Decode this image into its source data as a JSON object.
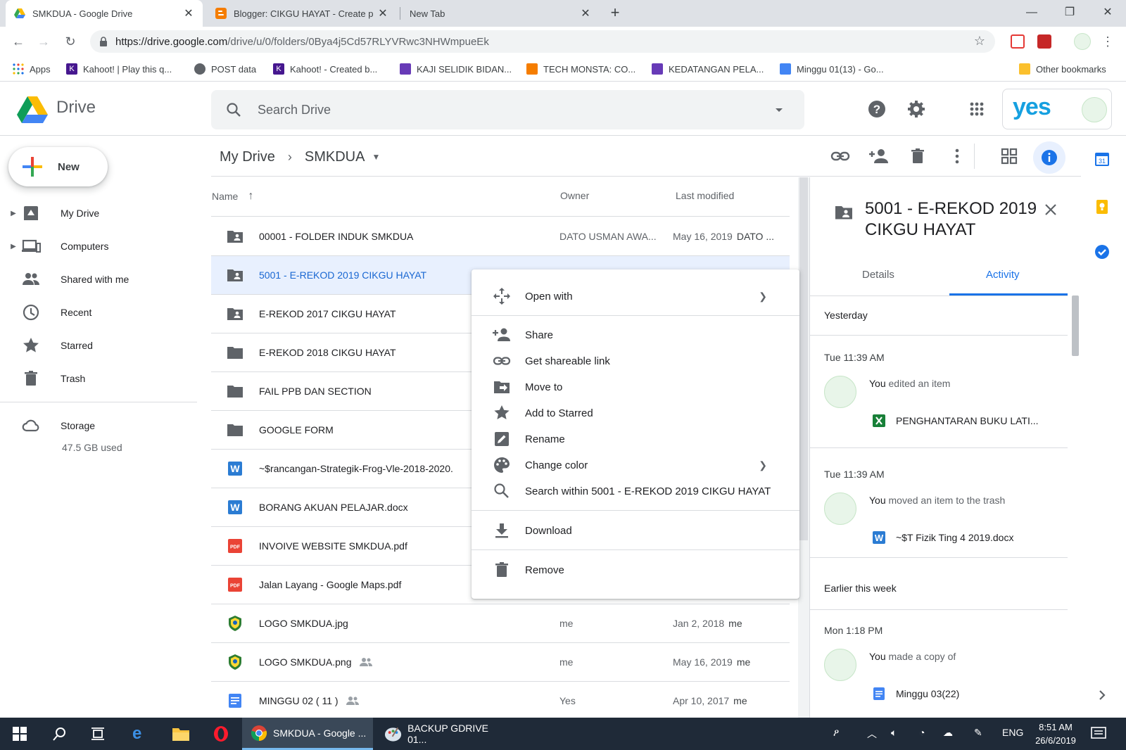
{
  "browser": {
    "tabs": [
      {
        "title": "SMKDUA - Google Drive",
        "active": true
      },
      {
        "title": "Blogger: CIKGU HAYAT - Create p",
        "active": false
      },
      {
        "title": "New Tab",
        "active": false
      }
    ],
    "new_tab": "+",
    "url_host": "https://drive.google.com",
    "url_path": "/drive/u/0/folders/0Bya4j5Cd57RLYVRwc3NHWmpueEk",
    "bookmarks": [
      {
        "label": "Apps"
      },
      {
        "label": "Kahoot! | Play this q..."
      },
      {
        "label": "POST data"
      },
      {
        "label": "Kahoot! - Created b..."
      },
      {
        "label": "KAJI SELIDIK BIDAN..."
      },
      {
        "label": "TECH MONSTA: CO..."
      },
      {
        "label": "KEDATANGAN PELA..."
      },
      {
        "label": "Minggu 01(13) - Go..."
      },
      {
        "label": "Other bookmarks"
      }
    ]
  },
  "drive": {
    "logo_text": "Drive",
    "search_placeholder": "Search Drive",
    "account_brand": "yes",
    "new_button": "New",
    "nav": [
      {
        "label": "My Drive",
        "icon": "my-drive-icon"
      },
      {
        "label": "Computers",
        "icon": "computers-icon"
      },
      {
        "label": "Shared with me",
        "icon": "shared-icon"
      },
      {
        "label": "Recent",
        "icon": "clock-icon"
      },
      {
        "label": "Starred",
        "icon": "star-icon"
      },
      {
        "label": "Trash",
        "icon": "trash-icon"
      }
    ],
    "storage": {
      "label": "Storage",
      "used": "47.5 GB used"
    },
    "breadcrumb": {
      "root": "My Drive",
      "current": "SMKDUA"
    },
    "columns": {
      "name": "Name",
      "owner": "Owner",
      "modified": "Last modified"
    },
    "files": [
      {
        "name": "00001 - FOLDER INDUK SMKDUA",
        "type": "shared-folder",
        "owner": "DATO USMAN AWA...",
        "modified": "May 16, 2019",
        "modified_by": "DATO ..."
      },
      {
        "name": "5001 - E-REKOD 2019 CIKGU HAYAT",
        "type": "shared-folder",
        "owner": "",
        "modified": "",
        "modified_by": "",
        "selected": true
      },
      {
        "name": "E-REKOD 2017 CIKGU HAYAT",
        "type": "shared-folder",
        "owner": "",
        "modified": "",
        "modified_by": ""
      },
      {
        "name": "E-REKOD 2018 CIKGU HAYAT",
        "type": "folder",
        "owner": "",
        "modified": "",
        "modified_by": ""
      },
      {
        "name": "FAIL PPB DAN SECTION",
        "type": "folder",
        "owner": "",
        "modified": "",
        "modified_by": ""
      },
      {
        "name": "GOOGLE FORM",
        "type": "folder",
        "owner": "",
        "modified": "",
        "modified_by": ""
      },
      {
        "name": "~$rancangan-Strategik-Frog-Vle-2018-2020.",
        "type": "word",
        "owner": "",
        "modified": "",
        "modified_by": ""
      },
      {
        "name": "BORANG AKUAN PELAJAR.docx",
        "type": "word",
        "owner": "",
        "modified": "",
        "modified_by": ""
      },
      {
        "name": "INVOIVE WEBSITE SMKDUA.pdf",
        "type": "pdf",
        "owner": "",
        "modified": "",
        "modified_by": ""
      },
      {
        "name": "Jalan Layang - Google Maps.pdf",
        "type": "pdf",
        "owner": "",
        "modified": "",
        "modified_by": ""
      },
      {
        "name": "LOGO SMKDUA.jpg",
        "type": "image",
        "owner": "me",
        "modified": "Jan 2, 2018",
        "modified_by": "me"
      },
      {
        "name": "LOGO SMKDUA.png",
        "type": "image",
        "owner": "me",
        "modified": "May 16, 2019",
        "modified_by": "me",
        "shared": true
      },
      {
        "name": "MINGGU 02 ( 11 )",
        "type": "doc",
        "owner": "Yes",
        "modified": "Apr 10, 2017",
        "modified_by": "me",
        "shared": true
      }
    ],
    "context_menu": [
      {
        "label": "Open with",
        "icon": "open-with-icon",
        "submenu": true
      },
      {
        "label": "Share",
        "icon": "share-icon"
      },
      {
        "label": "Get shareable link",
        "icon": "link-icon"
      },
      {
        "label": "Move to",
        "icon": "move-to-icon"
      },
      {
        "label": "Add to Starred",
        "icon": "star-icon"
      },
      {
        "label": "Rename",
        "icon": "rename-icon"
      },
      {
        "label": "Change color",
        "icon": "palette-icon",
        "submenu": true
      },
      {
        "label": "Search within 5001 - E-REKOD 2019 CIKGU HAYAT",
        "icon": "search-icon"
      },
      {
        "label": "Download",
        "icon": "download-icon"
      },
      {
        "label": "Remove",
        "icon": "trash-icon"
      }
    ],
    "details": {
      "title": "5001 - E-REKOD 2019 CIKGU HAYAT",
      "tab_details": "Details",
      "tab_activity": "Activity",
      "section_yesterday": "Yesterday",
      "section_earlier": "Earlier this week",
      "activities": [
        {
          "time": "Tue 11:39 AM",
          "actor": "You",
          "action": "edited an item",
          "file": "PENGHANTARAN BUKU LATI...",
          "file_type": "sheet"
        },
        {
          "time": "Tue 11:39 AM",
          "actor": "You",
          "action": "moved an item to the trash",
          "file": "~$T Fizik Ting 4 2019.docx",
          "file_type": "word"
        },
        {
          "time": "Mon 1:18 PM",
          "actor": "You",
          "action": "made a copy of",
          "file": "Minggu 03(22)",
          "file_type": "doc"
        }
      ]
    }
  },
  "taskbar": {
    "apps": [
      {
        "label": "SMKDUA - Google ...",
        "active": true
      },
      {
        "label": "BACKUP GDRIVE 01...",
        "active": false
      }
    ],
    "language": "ENG",
    "time": "8:51 AM",
    "date": "26/6/2019"
  },
  "colors": {
    "accent": "#1a73e8",
    "selected_row": "#e8f0fe",
    "yes_brand": "#16a0e0"
  }
}
